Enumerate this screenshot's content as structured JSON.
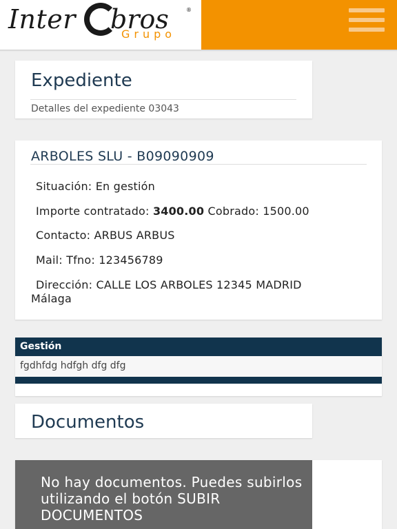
{
  "header": {
    "logo_inter": "Inter",
    "logo_bros": "bros",
    "logo_reg": "®",
    "logo_grupo": "Grupo",
    "brand_color": "#f39200",
    "menu_icon": "hamburger-menu-icon"
  },
  "expediente": {
    "title": "Expediente",
    "subtitle": "Detalles del expediente 03043"
  },
  "client": {
    "title": "ARBOLES SLU - B09090909",
    "situacion_label": "Situación:",
    "situacion_value": "En gestión",
    "importe_label": "Importe contratado:",
    "importe_value": "3400.00",
    "cobrado_label": "Cobrado:",
    "cobrado_value": "1500.00",
    "contacto_label": "Contacto:",
    "contacto_value": "ARBUS ARBUS",
    "mail_label": "Mail:",
    "tfno_label": "Tfno:",
    "tfno_value": "123456789",
    "direccion_label": "Dirección:",
    "direccion_value": "CALLE LOS ARBOLES 12345 MADRID",
    "direccion_city": "Málaga"
  },
  "gestion": {
    "header": "Gestión",
    "text": "fgdhfdg hdfgh dfg dfg",
    "header_color": "#11344d"
  },
  "documentos": {
    "title": "Documentos",
    "empty_message": "No hay documentos. Puedes subirlos utilizando el botón SUBIR DOCUMENTOS"
  }
}
